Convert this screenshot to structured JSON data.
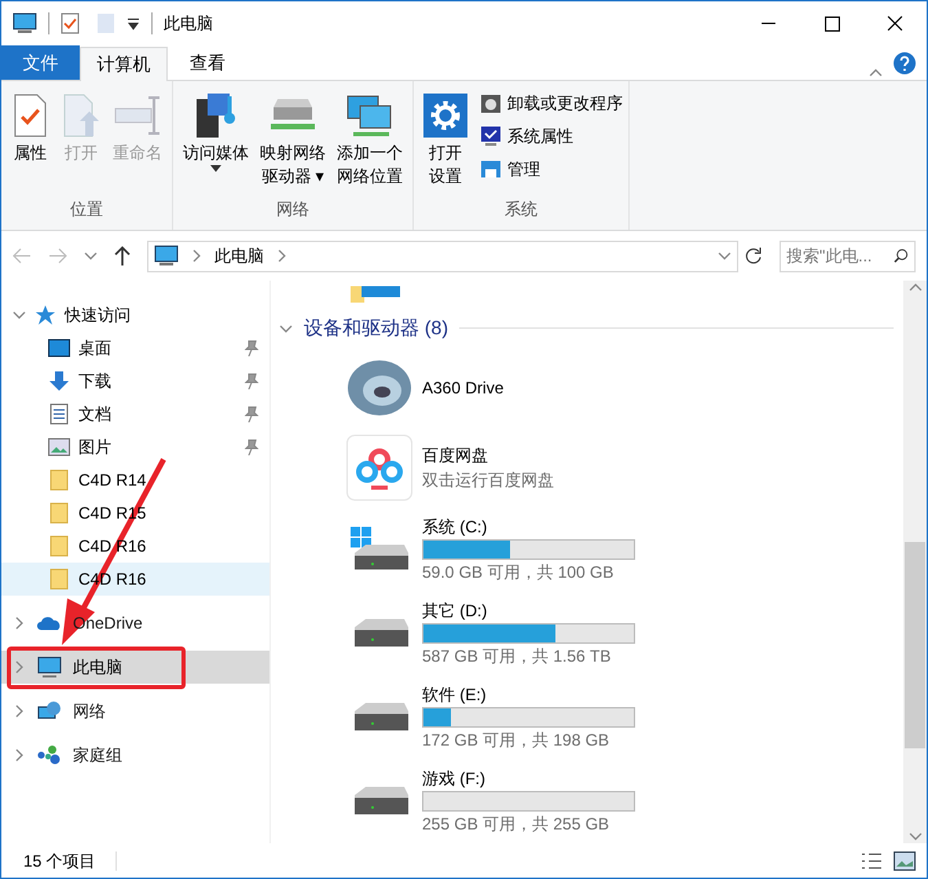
{
  "window": {
    "title": "此电脑"
  },
  "tabs": [
    {
      "label": "文件",
      "kind": "file",
      "selected": false
    },
    {
      "label": "计算机",
      "kind": "tab",
      "selected": true
    },
    {
      "label": "查看",
      "kind": "tab",
      "selected": false
    }
  ],
  "ribbon": [
    {
      "label": "位置",
      "buttons": [
        {
          "lines": [
            "属性"
          ],
          "kind": "properties",
          "disabled": false
        },
        {
          "lines": [
            "打开"
          ],
          "kind": "open",
          "disabled": true
        },
        {
          "lines": [
            "重命名"
          ],
          "kind": "rename",
          "disabled": true
        }
      ]
    },
    {
      "label": "网络",
      "buttons": [
        {
          "lines": [
            "访问媒体"
          ],
          "kind": "media",
          "disabled": false,
          "dropdown": true
        },
        {
          "lines": [
            "映射网络",
            "驱动器 ▾"
          ],
          "kind": "map-drive",
          "disabled": false,
          "dropdown": false
        },
        {
          "lines": [
            "添加一个",
            "网络位置"
          ],
          "kind": "add-location",
          "disabled": false,
          "dropdown": false
        }
      ]
    },
    {
      "label": "系统",
      "buttons": [
        {
          "lines": [
            "打开",
            "设置"
          ],
          "kind": "settings",
          "disabled": false
        }
      ],
      "small": [
        {
          "label": "卸载或更改程序",
          "kind": "uninstall"
        },
        {
          "label": "系统属性",
          "kind": "sysprops"
        },
        {
          "label": "管理",
          "kind": "manage"
        }
      ]
    }
  ],
  "address": {
    "path": "此电脑",
    "search_placeholder": "搜索\"此电..."
  },
  "nav": [
    {
      "label": "快速访问",
      "kind": "star",
      "selected": false,
      "children": [
        {
          "label": "桌面",
          "kind": "desktop",
          "pinned": true,
          "hover": false
        },
        {
          "label": "下载",
          "kind": "download",
          "pinned": true,
          "hover": false
        },
        {
          "label": "文档",
          "kind": "documents",
          "pinned": true,
          "hover": false
        },
        {
          "label": "图片",
          "kind": "pictures",
          "pinned": true,
          "hover": false
        },
        {
          "label": "C4D R14",
          "kind": "folder",
          "pinned": false,
          "hover": false
        },
        {
          "label": "C4D R15",
          "kind": "folder",
          "pinned": false,
          "hover": false
        },
        {
          "label": "C4D R16",
          "kind": "folder",
          "pinned": false,
          "hover": false
        },
        {
          "label": "C4D R16",
          "kind": "folder",
          "pinned": false,
          "hover": true
        }
      ]
    },
    {
      "label": "OneDrive",
      "kind": "cloud",
      "selected": false
    },
    {
      "label": "此电脑",
      "kind": "pc",
      "selected": true
    },
    {
      "label": "网络",
      "kind": "network",
      "selected": false
    },
    {
      "label": "家庭组",
      "kind": "homegroup",
      "selected": false
    }
  ],
  "section": {
    "title": "设备和驱动器 (8)",
    "items": [
      {
        "kind": "a360",
        "name": "A360 Drive"
      },
      {
        "kind": "baidu",
        "name": "百度网盘",
        "subtitle": "双击运行百度网盘"
      },
      {
        "kind": "system-drive",
        "name": "系统 (C:)",
        "level": 0.41,
        "reading": "59.0 GB 可用，共 100 GB"
      },
      {
        "kind": "drive",
        "name": "其它 (D:)",
        "level": 0.63,
        "reading": "587 GB 可用，共 1.56 TB"
      },
      {
        "kind": "drive",
        "name": "软件 (E:)",
        "level": 0.13,
        "reading": "172 GB 可用，共 198 GB"
      },
      {
        "kind": "drive",
        "name": "游戏 (F:)",
        "level": 0,
        "reading": "255 GB 可用，共 255 GB"
      }
    ]
  },
  "status_bar": {
    "count": "15 个项目"
  }
}
